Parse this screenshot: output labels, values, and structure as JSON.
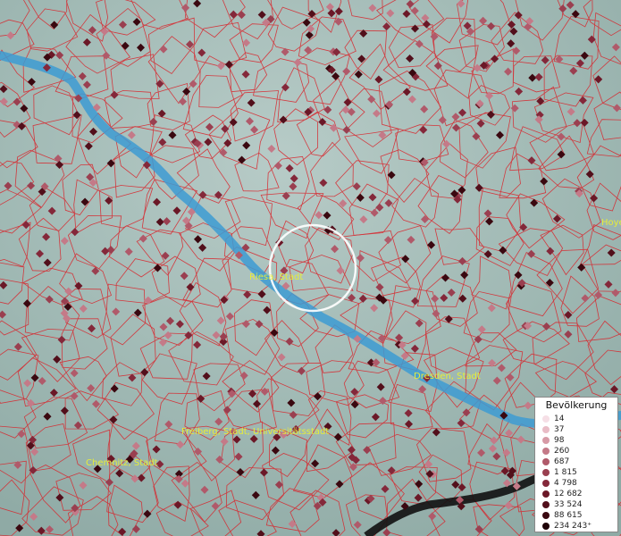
{
  "map": {
    "colors": {
      "terrain_base": "#a6bfba",
      "boundary": "#d9232a",
      "river": "#3d9bd2",
      "city_label": "#e6ec3a",
      "focus_ring": "#ffffff"
    },
    "cities": [
      {
        "name": "Riesa, Stadt"
      },
      {
        "name": "Dresden, Stadt"
      },
      {
        "name": "Freiberg, Stadt, Universitätsstadt"
      },
      {
        "name": "Chemnitz, Stadt"
      },
      {
        "name": "Hoye"
      }
    ]
  },
  "legend": {
    "title": "Bevölkerung",
    "entries": [
      {
        "label": "14",
        "color": "#f6dfe6"
      },
      {
        "label": "37",
        "color": "#e9bcc6"
      },
      {
        "label": "98",
        "color": "#d79aa6"
      },
      {
        "label": "260",
        "color": "#c47a88"
      },
      {
        "label": "687",
        "color": "#b05a6a"
      },
      {
        "label": "1 815",
        "color": "#9a3f50"
      },
      {
        "label": "4 798",
        "color": "#84283a"
      },
      {
        "label": "12 682",
        "color": "#6b1827"
      },
      {
        "label": "33 524",
        "color": "#520f1b"
      },
      {
        "label": "88 615",
        "color": "#3a0810"
      },
      {
        "label": "234 243⁺",
        "color": "#1e0307"
      }
    ]
  }
}
